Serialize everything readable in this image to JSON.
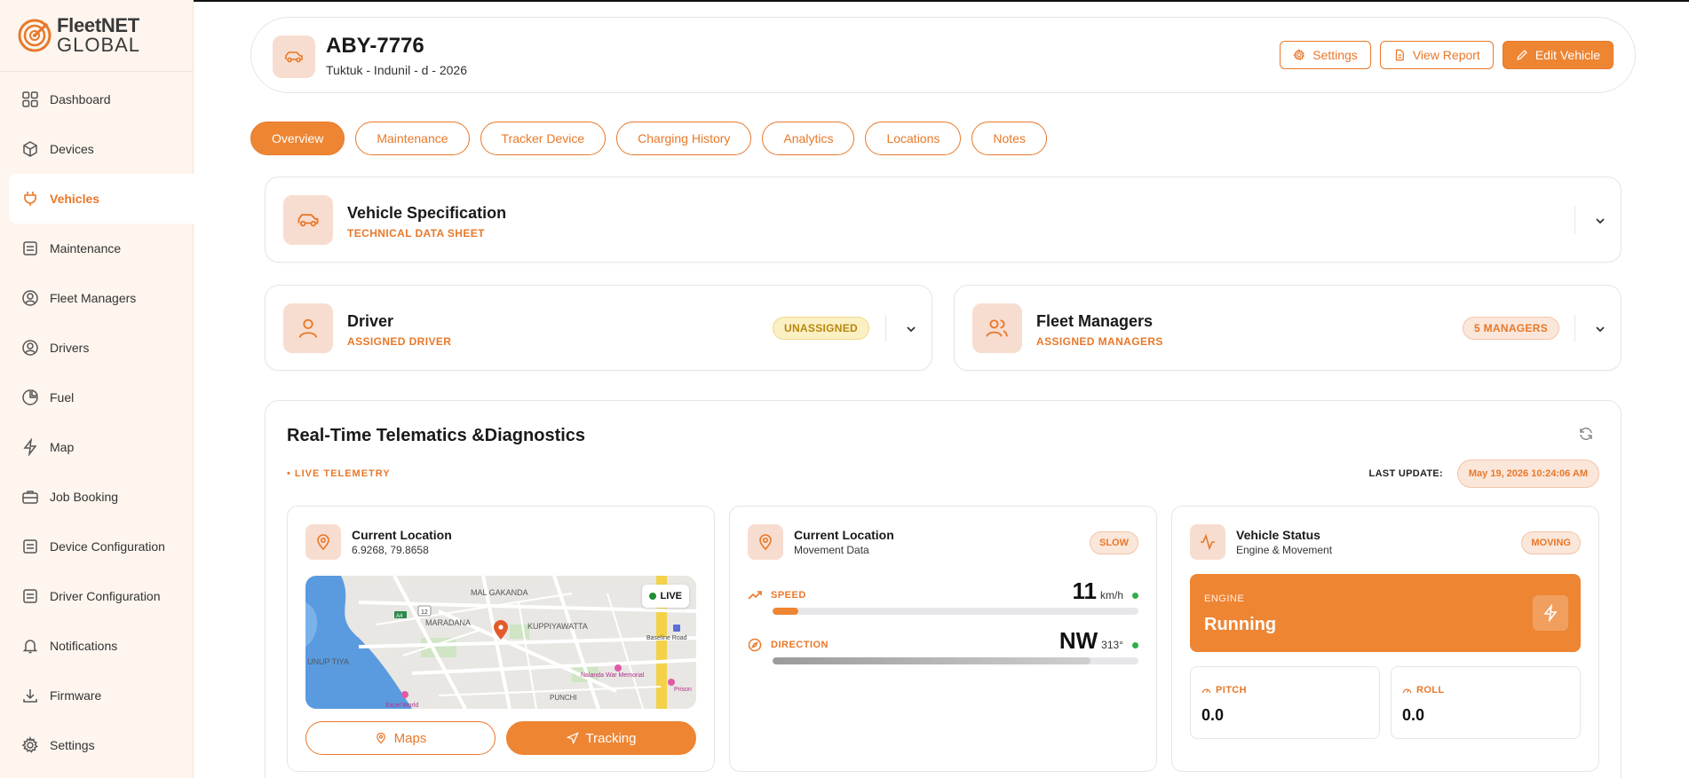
{
  "brand": {
    "line1": "FleetNET",
    "line2": "GLOBAL"
  },
  "sidebar": {
    "items": [
      {
        "label": "Dashboard",
        "icon": "grid-icon"
      },
      {
        "label": "Devices",
        "icon": "box-icon"
      },
      {
        "label": "Vehicles",
        "icon": "plug-icon",
        "active": true
      },
      {
        "label": "Maintenance",
        "icon": "clipboard-icon"
      },
      {
        "label": "Fleet Managers",
        "icon": "user-circle-icon"
      },
      {
        "label": "Drivers",
        "icon": "user-circle-icon"
      },
      {
        "label": "Fuel",
        "icon": "pie-icon"
      },
      {
        "label": "Map",
        "icon": "bolt-icon"
      },
      {
        "label": "Job Booking",
        "icon": "briefcase-icon"
      },
      {
        "label": "Device Configuration",
        "icon": "list-icon"
      },
      {
        "label": "Driver Configuration",
        "icon": "list-icon"
      },
      {
        "label": "Notifications",
        "icon": "bell-icon"
      },
      {
        "label": "Firmware",
        "icon": "download-icon"
      },
      {
        "label": "Settings",
        "icon": "gear-icon"
      }
    ]
  },
  "header": {
    "plate": "ABY-7776",
    "subtitle": "Tuktuk - Indunil - d - 2026",
    "settings_label": "Settings",
    "report_label": "View Report",
    "edit_label": "Edit Vehicle"
  },
  "tabs": [
    "Overview",
    "Maintenance",
    "Tracker Device",
    "Charging History",
    "Analytics",
    "Locations",
    "Notes"
  ],
  "spec_card": {
    "title": "Vehicle Specification",
    "subtitle": "TECHNICAL DATA SHEET"
  },
  "driver_card": {
    "title": "Driver",
    "subtitle": "ASSIGNED DRIVER",
    "badge": "UNASSIGNED"
  },
  "managers_card": {
    "title": "Fleet Managers",
    "subtitle": "ASSIGNED MANAGERS",
    "badge": "5 MANAGERS"
  },
  "telemetry": {
    "title": "Real-Time Telematics &Diagnostics",
    "live_label": "• LIVE TELEMETRY",
    "last_update_label": "LAST UPDATE:",
    "last_update_value": "May 19, 2026 10:24:06 AM"
  },
  "location_card": {
    "title": "Current Location",
    "coords": "6.9268, 79.8658",
    "live_badge": "LIVE",
    "maps_label": "Maps",
    "tracking_label": "Tracking",
    "map_labels": [
      "MAL GAKANDA",
      "MARADANA",
      "KUPPIYAWATTA",
      "UNUP TIYA",
      "Baseline Road",
      "Nalanda War Memorial",
      "PUNCHI",
      "Excel World",
      "Prison",
      "12",
      "A4"
    ]
  },
  "movement_card": {
    "title": "Current Location",
    "subtitle": "Movement Data",
    "badge": "SLOW",
    "speed_label": "SPEED",
    "speed_value": "11",
    "speed_unit": "km/h",
    "speed_progress": 0.07,
    "direction_label": "DIRECTION",
    "direction_value": "NW",
    "direction_degrees": "313°",
    "direction_progress": 0.87
  },
  "status_card": {
    "title": "Vehicle Status",
    "subtitle": "Engine & Movement",
    "badge": "MOVING",
    "engine_label": "ENGINE",
    "engine_value": "Running",
    "pitch_label": "PITCH",
    "pitch_value": "0.0",
    "roll_label": "ROLL",
    "roll_value": "0.0"
  },
  "colors": {
    "accent": "#ee8533",
    "accent_text": "#e8782a",
    "accent_soft": "#f7ddd0",
    "sidebar_bg": "#fdf5ee"
  }
}
